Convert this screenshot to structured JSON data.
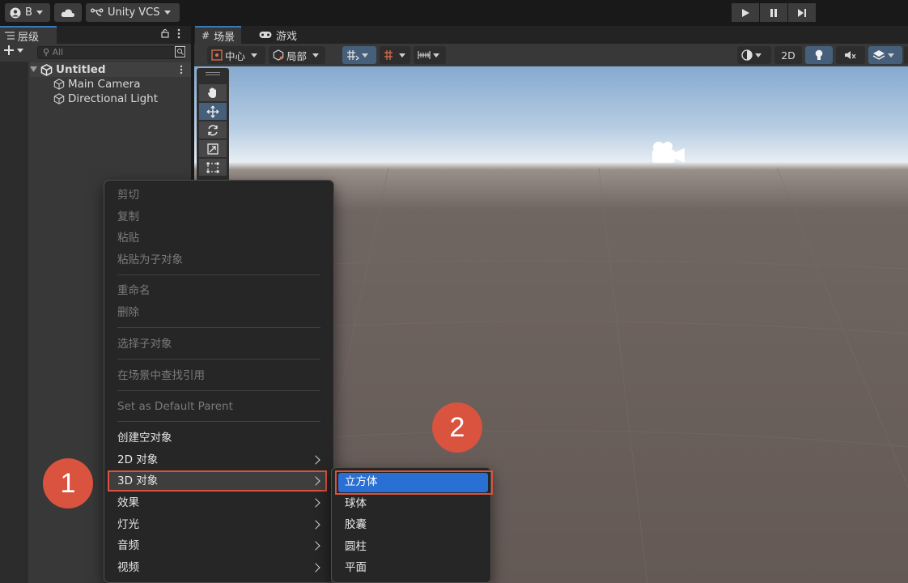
{
  "topbar": {
    "account_label": "B",
    "vcs_label": "Unity VCS"
  },
  "hierarchy": {
    "tab_label": "层级",
    "search_placeholder": "All",
    "scene_name": "Untitled",
    "objects": [
      "Main Camera",
      "Directional Light"
    ]
  },
  "scene": {
    "tabs": [
      "场景",
      "游戏"
    ],
    "pivot_label": "中心",
    "space_label": "局部",
    "mode_2d": "2D"
  },
  "context_menu": {
    "items": [
      {
        "label": "剪切",
        "enabled": false
      },
      {
        "label": "复制",
        "enabled": false
      },
      {
        "label": "粘贴",
        "enabled": false
      },
      {
        "label": "粘贴为子对象",
        "enabled": false
      },
      {
        "label": "重命名",
        "enabled": false
      },
      {
        "label": "删除",
        "enabled": false
      },
      {
        "label": "选择子对象",
        "enabled": false
      },
      {
        "label": "在场景中查找引用",
        "enabled": false
      },
      {
        "label": "Set as Default Parent",
        "enabled": false
      },
      {
        "label": "创建空对象",
        "enabled": true
      },
      {
        "label": "2D 对象",
        "enabled": true,
        "submenu": true
      },
      {
        "label": "3D 对象",
        "enabled": true,
        "submenu": true,
        "highlighted": true
      },
      {
        "label": "效果",
        "enabled": true,
        "submenu": true
      },
      {
        "label": "灯光",
        "enabled": true,
        "submenu": true
      },
      {
        "label": "音频",
        "enabled": true,
        "submenu": true
      },
      {
        "label": "视频",
        "enabled": true,
        "submenu": true
      }
    ]
  },
  "submenu_3d": {
    "items": [
      {
        "label": "立方体",
        "selected": true
      },
      {
        "label": "球体"
      },
      {
        "label": "胶囊"
      },
      {
        "label": "圆柱"
      },
      {
        "label": "平面"
      }
    ]
  },
  "steps": [
    "1",
    "2"
  ],
  "colors": {
    "accent_orange": "#d9533e",
    "selection_blue": "#2a6fd4",
    "active_tool_blue": "#46607c"
  }
}
